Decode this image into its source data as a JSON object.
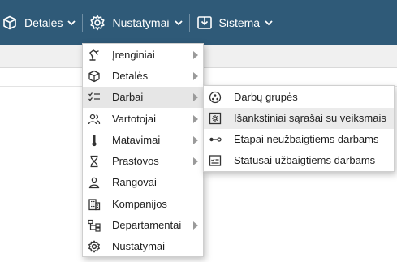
{
  "navbar": {
    "background": "#2f5a78",
    "items": [
      {
        "label": "Detalės",
        "icon": "cube-icon"
      },
      {
        "label": "Nustatymai",
        "icon": "gear-icon"
      },
      {
        "label": "Sistema",
        "icon": "import-icon"
      }
    ]
  },
  "menu": {
    "items": [
      {
        "label": "Įrenginiai",
        "icon": "robot-arm-icon",
        "submenu": true
      },
      {
        "label": "Detalės",
        "icon": "cube-icon",
        "submenu": true
      },
      {
        "label": "Darbai",
        "icon": "checklist-icon",
        "submenu": true,
        "active": true
      },
      {
        "label": "Vartotojai",
        "icon": "users-icon",
        "submenu": true
      },
      {
        "label": "Matavimai",
        "icon": "thermometer-icon",
        "submenu": true
      },
      {
        "label": "Prastovos",
        "icon": "hourglass-icon",
        "submenu": true
      },
      {
        "label": "Rangovai",
        "icon": "person-icon",
        "submenu": false
      },
      {
        "label": "Kompanijos",
        "icon": "building-icon",
        "submenu": false
      },
      {
        "label": "Departamentai",
        "icon": "org-chart-icon",
        "submenu": true
      },
      {
        "label": "Nustatymai",
        "icon": "gear-icon",
        "submenu": false
      }
    ]
  },
  "submenu": {
    "items": [
      {
        "label": "Darbų grupės",
        "icon": "group-icon"
      },
      {
        "label": "Išankstiniai sąrašai su veiksmais",
        "icon": "settings-box-icon",
        "hover": true
      },
      {
        "label": "Etapai neužbaigtiems darbams",
        "icon": "stages-icon"
      },
      {
        "label": "Statusai užbaigtiems darbams",
        "icon": "status-list-icon"
      }
    ]
  }
}
